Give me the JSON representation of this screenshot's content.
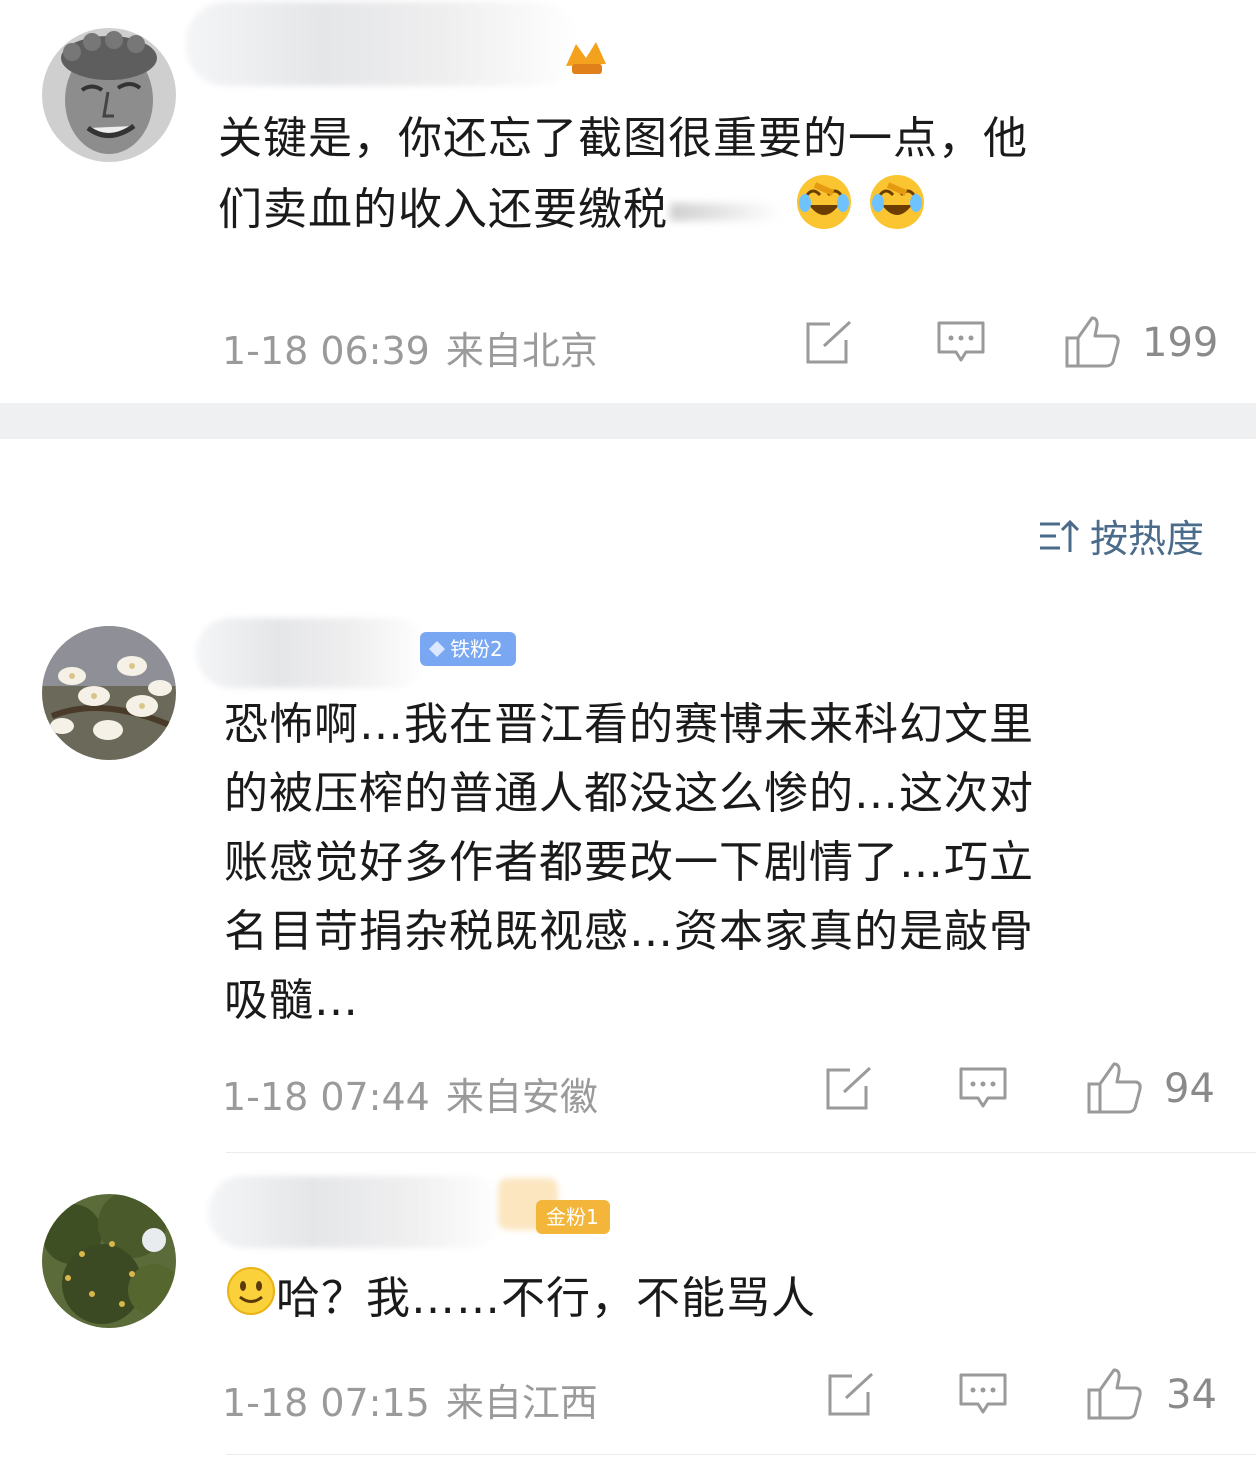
{
  "comments": [
    {
      "text_line1": "关键是，你还忘了截图很重要的一点，他",
      "text_line2": "们卖血的收入还要缴税",
      "time": "1-18 06:39",
      "location": "来自北京",
      "likes": "199",
      "emoji_icons": [
        "laughing-crying-icon",
        "laughing-crying-icon"
      ]
    },
    {
      "badge": "铁粉2",
      "text": "恐怖啊…我在晋江看的赛博未来科幻文里的被压榨的普通人都没这么惨的…这次对账感觉好多作者都要改一下剧情了…巧立名目苛捐杂税既视感…资本家真的是敲骨吸髓…",
      "text_lines": [
        "恐怖啊…我在晋江看的赛博未来科幻文里",
        "的被压榨的普通人都没这么惨的…这次对",
        "账感觉好多作者都要改一下剧情了…巧立",
        "名目苛捐杂税既视感…资本家真的是敲骨",
        "吸髓…"
      ],
      "time": "1-18 07:44",
      "location": "来自安徽",
      "likes": "94"
    },
    {
      "badge": "金粉1",
      "text": "哈？我……不行，不能骂人",
      "time": "1-18 07:15",
      "location": "来自江西",
      "likes": "34"
    }
  ],
  "sort_label": "按热度",
  "colors": {
    "meta_gray": "#9a9a9a",
    "sort_blue": "#4a6b8a",
    "iron_fan_badge": "#6fa0f0",
    "gold_fan_badge": "#f3b63a"
  }
}
